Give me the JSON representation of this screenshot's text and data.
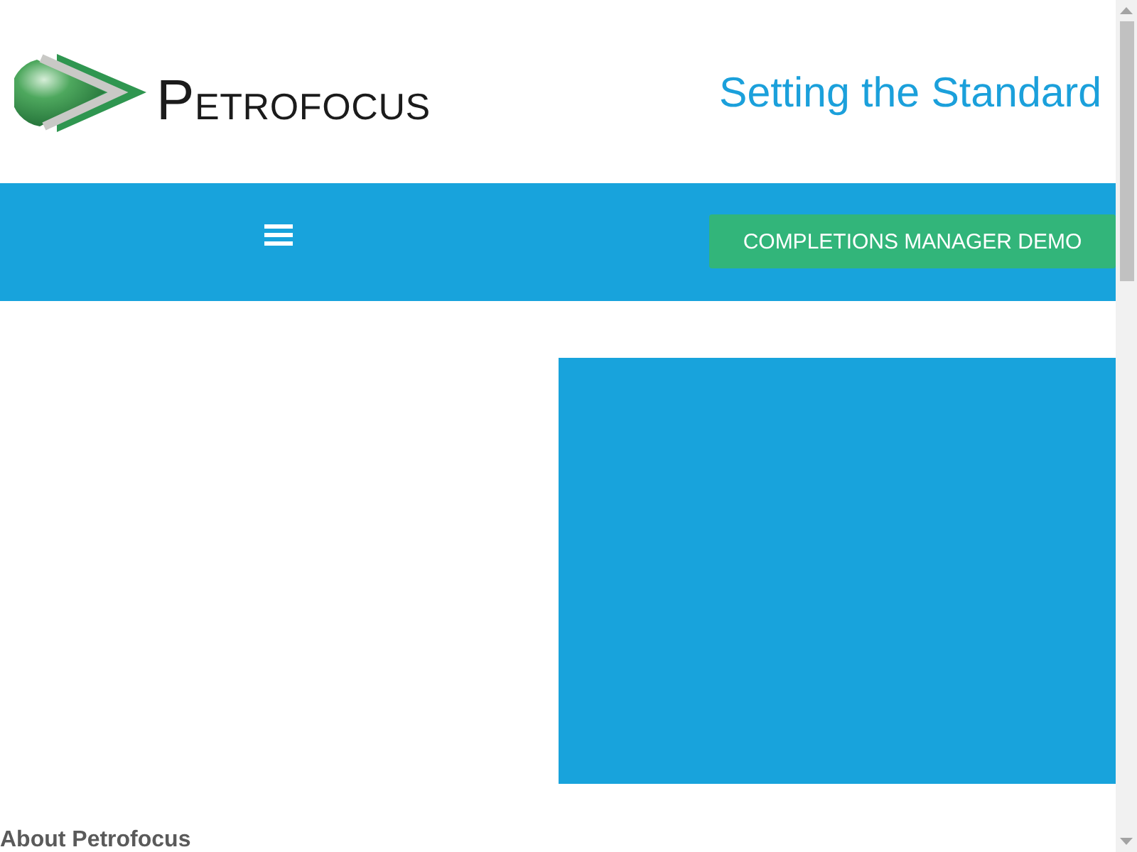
{
  "header": {
    "logo_text": "PETROFOCUS",
    "tagline": "Setting the Standard"
  },
  "nav": {
    "cta_button": "COMPLETIONS MANAGER DEMO"
  },
  "about": {
    "heading": "About Petrofocus"
  }
}
